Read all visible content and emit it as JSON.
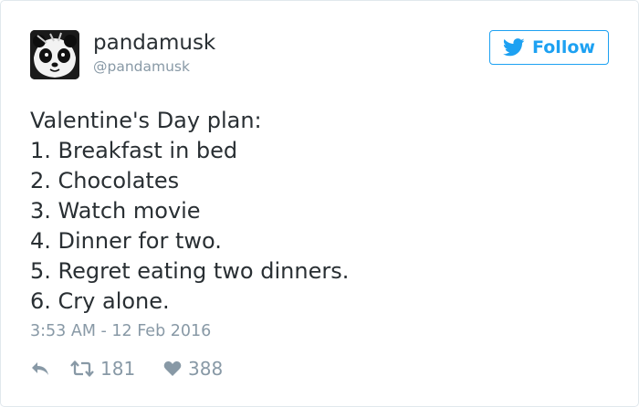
{
  "user": {
    "display_name": "pandamusk",
    "handle": "@pandamusk"
  },
  "follow_button": {
    "label": "Follow",
    "icon": "twitter-bird-icon"
  },
  "tweet": {
    "lines": [
      "Valentine's Day plan:",
      "1. Breakfast in bed",
      "2. Chocolates",
      "3. Watch movie",
      "4. Dinner for two.",
      "5. Regret eating two dinners.",
      "6. Cry alone."
    ],
    "timestamp": "3:53 AM - 12 Feb 2016"
  },
  "actions": {
    "reply_icon": "reply-icon",
    "retweet_icon": "retweet-icon",
    "retweet_count": "181",
    "like_icon": "heart-icon",
    "like_count": "388"
  },
  "colors": {
    "brand": "#1da1f2",
    "text": "#292f33",
    "muted": "#8899a6",
    "border": "#e1e8ed"
  }
}
